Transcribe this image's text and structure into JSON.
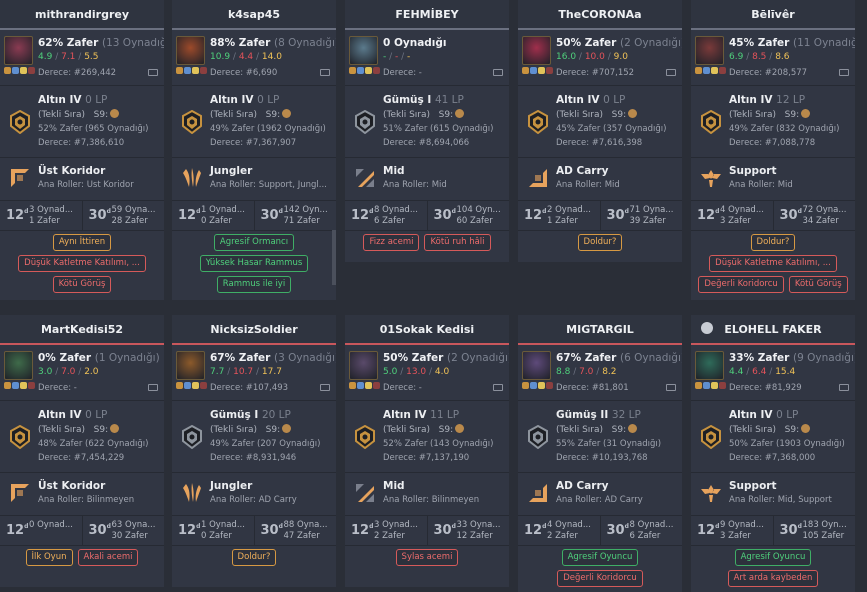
{
  "cards": [
    {
      "name": "mithrandirgrey",
      "winrate": "62% Zafer",
      "played": "(13 Oynadığı)",
      "k": "4.9",
      "d": "7.1",
      "a": "5.5",
      "rank_line": "Derece: #269,442",
      "tier": "Altın IV",
      "lp": "0 LP",
      "queue": "(Tekli Sıra)",
      "season": "S9:",
      "ranked_wr": "52% Zafer (965 Oynadığı)",
      "ranked_rank": "Derece: #7,386,610",
      "role": "Üst Koridor",
      "role_sub": "Ana Roller: Üst Koridor",
      "s12a": "3 Oynad...",
      "s12b": "1 Zafer",
      "s30a": "59 Oyna...",
      "s30b": "28 Zafer",
      "tags": [
        {
          "t": "Aynı İttiren",
          "c": "warn"
        },
        {
          "t": "Düşük Katletme Katılımı, ...",
          "c": "bad"
        },
        {
          "t": "Kötü Görüş",
          "c": "bad"
        }
      ]
    },
    {
      "name": "k4sap45",
      "winrate": "88% Zafer",
      "played": "(8 Oynadığı)",
      "k": "10.9",
      "d": "4.4",
      "a": "14.0",
      "rank_line": "Derece: #6,690",
      "tier": "Altın IV",
      "lp": "0 LP",
      "queue": "(Tekli Sıra)",
      "season": "S9:",
      "ranked_wr": "49% Zafer (1962 Oynadığı)",
      "ranked_rank": "Derece: #7,367,907",
      "role": "Jungler",
      "role_sub": "Ana Roller: Support, Jungl...",
      "s12a": "1 Oynad...",
      "s12b": "0 Zafer",
      "s30a": "142 Oyn...",
      "s30b": "71 Zafer",
      "tags": [
        {
          "t": "Agresif Ormancı",
          "c": "good"
        },
        {
          "t": "Yüksek Hasar Rammus",
          "c": "good"
        },
        {
          "t": "Rammus ile iyi",
          "c": "good"
        }
      ]
    },
    {
      "name": "FEHMİBEY",
      "winrate": "0 Oynadığı",
      "played": "",
      "k": "-",
      "d": "-",
      "a": "-",
      "rank_line": "Derece: -",
      "tier": "Gümüş I",
      "lp": "41 LP",
      "queue": "(Tekli Sıra)",
      "season": "S9:",
      "ranked_wr": "51% Zafer (615 Oynadığı)",
      "ranked_rank": "Derece: #8,694,066",
      "role": "Mid",
      "role_sub": "Ana Roller: Mid",
      "s12a": "8 Oynad...",
      "s12b": "6 Zafer",
      "s30a": "104 Oyn...",
      "s30b": "60 Zafer",
      "tags": [
        {
          "t": "Fizz acemi",
          "c": "bad"
        },
        {
          "t": "Kötü ruh hâli",
          "c": "bad"
        }
      ]
    },
    {
      "name": "TheCORONAa",
      "winrate": "50% Zafer",
      "played": "(2 Oynadığı)",
      "k": "16.0",
      "d": "10.0",
      "a": "9.0",
      "rank_line": "Derece: #707,152",
      "tier": "Altın IV",
      "lp": "0 LP",
      "queue": "(Tekli Sıra)",
      "season": "S9:",
      "ranked_wr": "45% Zafer (357 Oynadığı)",
      "ranked_rank": "Derece: #7,616,398",
      "role": "AD Carry",
      "role_sub": "Ana Roller: Mid",
      "s12a": "2 Oynad...",
      "s12b": "1 Zafer",
      "s30a": "71 Oyna...",
      "s30b": "39 Zafer",
      "tags": [
        {
          "t": "Doldur?",
          "c": "warn"
        }
      ]
    },
    {
      "name": "Bēlīvêr",
      "winrate": "45% Zafer",
      "played": "(11 Oynadığı)",
      "k": "6.9",
      "d": "8.5",
      "a": "8.6",
      "rank_line": "Derece: #208,577",
      "tier": "Altın IV",
      "lp": "12 LP",
      "queue": "(Tekli Sıra)",
      "season": "S9:",
      "ranked_wr": "49% Zafer (832 Oynadığı)",
      "ranked_rank": "Derece: #7,088,778",
      "role": "Support",
      "role_sub": "Ana Roller: Mid",
      "s12a": "4 Oynad...",
      "s12b": "3 Zafer",
      "s30a": "72 Oyna...",
      "s30b": "34 Zafer",
      "tags": [
        {
          "t": "Doldur?",
          "c": "warn"
        },
        {
          "t": "Düşük Katletme Katılımı, ...",
          "c": "bad"
        },
        {
          "t": "Değerli Koridorcu",
          "c": "bad"
        },
        {
          "t": "Kötü Görüş",
          "c": "bad"
        }
      ]
    },
    {
      "name": "MartKedisi52",
      "winrate": "0% Zafer",
      "played": "(1 Oynadığı)",
      "k": "3.0",
      "d": "7.0",
      "a": "2.0",
      "rank_line": "Derece: -",
      "tier": "Altın IV",
      "lp": "0 LP",
      "queue": "(Tekli Sıra)",
      "season": "S9:",
      "ranked_wr": "48% Zafer (622 Oynadığı)",
      "ranked_rank": "Derece: #7,454,229",
      "role": "Üst Koridor",
      "role_sub": "Ana Roller: Bilinmeyen",
      "s12a": "0 Oynad...",
      "s12b": "",
      "s30a": "63 Oyna...",
      "s30b": "30 Zafer",
      "tags": [
        {
          "t": "İlk Oyun",
          "c": "warn"
        },
        {
          "t": "Akali acemi",
          "c": "bad"
        }
      ]
    },
    {
      "name": "NicksizSoldier",
      "winrate": "67% Zafer",
      "played": "(3 Oynadığı)",
      "k": "7.7",
      "d": "10.7",
      "a": "17.7",
      "rank_line": "Derece: #107,493",
      "tier": "Gümüş I",
      "lp": "20 LP",
      "queue": "(Tekli Sıra)",
      "season": "S9:",
      "ranked_wr": "49% Zafer (207 Oynadığı)",
      "ranked_rank": "Derece: #8,931,946",
      "role": "Jungler",
      "role_sub": "Ana Roller: AD Carry",
      "s12a": "1 Oynad...",
      "s12b": "0 Zafer",
      "s30a": "88 Oyna...",
      "s30b": "47 Zafer",
      "tags": [
        {
          "t": "Doldur?",
          "c": "warn"
        }
      ]
    },
    {
      "name": "01Sokak Kedisi",
      "winrate": "50% Zafer",
      "played": "(2 Oynadığı)",
      "k": "5.0",
      "d": "13.0",
      "a": "4.0",
      "rank_line": "Derece: -",
      "tier": "Altın IV",
      "lp": "11 LP",
      "queue": "(Tekli Sıra)",
      "season": "S9:",
      "ranked_wr": "52% Zafer (143 Oynadığı)",
      "ranked_rank": "Derece: #7,137,190",
      "role": "Mid",
      "role_sub": "Ana Roller: Bilinmeyen",
      "s12a": "3 Oynad...",
      "s12b": "2 Zafer",
      "s30a": "33 Oyna...",
      "s30b": "12 Zafer",
      "tags": [
        {
          "t": "Sylas acemi",
          "c": "bad"
        }
      ]
    },
    {
      "name": "MIGTARGIL",
      "winrate": "67% Zafer",
      "played": "(6 Oynadığı)",
      "k": "8.8",
      "d": "7.0",
      "a": "8.2",
      "rank_line": "Derece: #81,801",
      "tier": "Gümüş II",
      "lp": "32 LP",
      "queue": "(Tekli Sıra)",
      "season": "S9:",
      "ranked_wr": "55% Zafer (31 Oynadığı)",
      "ranked_rank": "Derece: #10,193,768",
      "role": "AD Carry",
      "role_sub": "Ana Roller: AD Carry",
      "s12a": "4 Oynad...",
      "s12b": "2 Zafer",
      "s30a": "8 Oynad...",
      "s30b": "6 Zafer",
      "tags": [
        {
          "t": "Agresif Oyuncu",
          "c": "good"
        },
        {
          "t": "Değerli Koridorcu",
          "c": "bad"
        }
      ]
    },
    {
      "name": "ELOHELL FAKER",
      "winrate": "33% Zafer",
      "played": "(9 Oynadığı)",
      "k": "4.4",
      "d": "6.4",
      "a": "15.4",
      "rank_line": "Derece: #81,929",
      "tier": "Altın IV",
      "lp": "0 LP",
      "queue": "(Tekli Sıra)",
      "season": "S9:",
      "ranked_wr": "50% Zafer (1903 Oynadığı)",
      "ranked_rank": "Derece: #7,368,000",
      "role": "Support",
      "role_sub": "Ana Roller: Mid, Support",
      "s12a": "9 Oynad...",
      "s12b": "3 Zafer",
      "s30a": "183 Oyn...",
      "s30b": "105 Zafer",
      "tags": [
        {
          "t": "Agresif Oyuncu",
          "c": "good"
        },
        {
          "t": "Art arda kaybeden",
          "c": "bad"
        }
      ]
    }
  ],
  "stat_12_label": "12",
  "stat_30_label": "30",
  "colors": {
    "win": "#4fd07c",
    "loss": "#e4535a",
    "assist": "#f0c257",
    "gold": "#c6923f",
    "silver": "#8e959e"
  }
}
